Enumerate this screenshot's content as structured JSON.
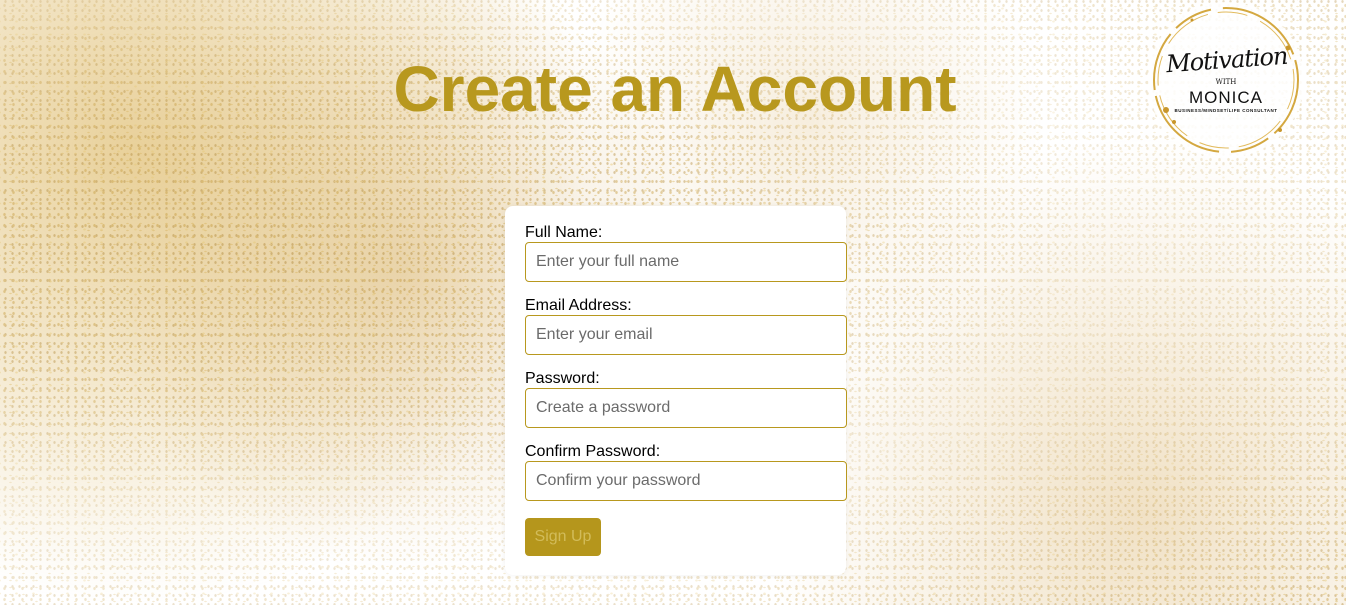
{
  "page": {
    "title": "Create an Account"
  },
  "logo": {
    "script_text": "Motivation",
    "with_text": "WITH",
    "name": "MONICA",
    "tagline": "BUSINESS/MINDSET/LIFE CONSULTANT"
  },
  "form": {
    "fields": [
      {
        "label": "Full Name:",
        "placeholder": "Enter your full name",
        "type": "text"
      },
      {
        "label": "Email Address:",
        "placeholder": "Enter your email",
        "type": "email"
      },
      {
        "label": "Password:",
        "placeholder": "Create a password",
        "type": "password"
      },
      {
        "label": "Confirm Password:",
        "placeholder": "Confirm your password",
        "type": "password"
      }
    ],
    "submit_label": "Sign Up"
  },
  "colors": {
    "accent": "#b8981e",
    "button_bg": "#b5961c",
    "button_text": "#d2bc5a"
  }
}
